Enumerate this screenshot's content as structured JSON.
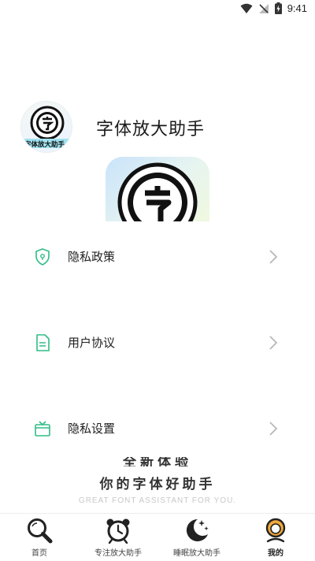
{
  "status_bar": {
    "time": "9:41"
  },
  "app": {
    "title": "字体放大助手",
    "logo_text": "字体放大助手"
  },
  "menu": {
    "items": [
      {
        "label": "隐私政策",
        "icon": "shield-icon"
      },
      {
        "label": "用户协议",
        "icon": "document-icon"
      },
      {
        "label": "隐私设置",
        "icon": "tv-box-icon"
      }
    ]
  },
  "slogan": {
    "top_text": "全新体验",
    "main": "你的字体好助手",
    "sub": "GREAT FONT ASSISTANT FOR YOU."
  },
  "tabs": [
    {
      "label": "首页",
      "icon": "magnifier-icon"
    },
    {
      "label": "专注放大助手",
      "icon": "alarm-clock-icon"
    },
    {
      "label": "睡眠放大助手",
      "icon": "moon-stars-icon"
    },
    {
      "label": "我的",
      "icon": "profile-icon",
      "active": true
    }
  ],
  "colors": {
    "accent_green": "#2ebd85",
    "tab_active_orange": "#f2a93b",
    "chevron_gray": "#b8b8b8"
  }
}
